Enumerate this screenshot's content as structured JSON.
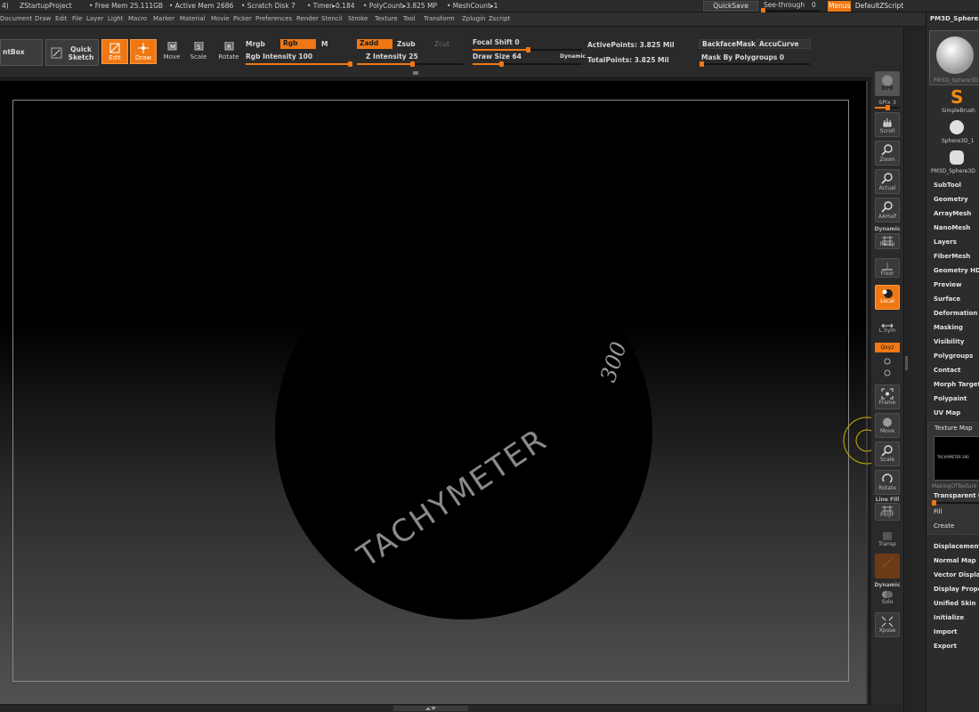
{
  "titlebar": {
    "fragments": [
      "4)",
      "ZStartupProject",
      "• Free Mem 25.111GB",
      "• Active Mem 2686",
      "• Scratch Disk 7",
      "• Timer▸0.184",
      "• PolyCount▸3.825 MP",
      "• MeshCount▸1"
    ],
    "quicksave": "QuickSave",
    "see_through": "See-through",
    "see_through_value": "0",
    "menus": "Menus",
    "default_zscript": "DefaultZScript"
  },
  "menubar": [
    "Document",
    "Draw",
    "Edit",
    "File",
    "Layer",
    "Light",
    "Macro",
    "Marker",
    "Material",
    "Movie",
    "Picker",
    "Preferences",
    "Render",
    "Stencil",
    "Stroke",
    "Texture",
    "Tool",
    "Transform",
    "Zplugin",
    "Zscript"
  ],
  "shelf": {
    "lightbox": "ntBox",
    "quick_sketch": "Quick Sketch",
    "edit": "Edit",
    "draw": "Draw",
    "move": "Move",
    "scale": "Scale",
    "rotate": "Rotate",
    "mrgb": "Mrgb",
    "rgb": "Rgb",
    "m": "M",
    "zadd": "Zadd",
    "zsub": "Zsub",
    "zcut": "Zcut",
    "rgb_intensity": "Rgb Intensity 100",
    "z_intensity": "Z Intensity 25",
    "focal_shift": "Focal Shift 0",
    "draw_size": "Draw Size 64",
    "dynamic": "Dynamic",
    "active_points": "ActivePoints: 3.825 Mil",
    "total_points": "TotalPoints: 3.825 Mil",
    "backface_mask": "BackfaceMask",
    "accu_curve": "AccuCurve",
    "mask_by_polygroups": "Mask By Polygroups 0"
  },
  "canvas": {
    "text_main": "TACHYMETER",
    "text_number": "300"
  },
  "rightcol": {
    "bpr": "BPR",
    "spix": "SPix 3",
    "scroll": "Scroll",
    "zoom": "Zoom",
    "actual": "Actual",
    "aahalf": "AAHalf",
    "dynamic": "Dynamic",
    "persp": "Persp",
    "floor": "Floor",
    "local": "Local",
    "lsym": "L.Sym",
    "xyz": "Qxyz",
    "frame": "Frame",
    "move": "Move",
    "scale": "Scale",
    "rotate": "Rotate",
    "line_fill": "Line Fill",
    "polyf": "PolyF",
    "transp": "Transp",
    "dynamic2": "Dynamic",
    "solo": "Solo",
    "xpose": "Xpose"
  },
  "palette": {
    "header": "PM3D_Sphere3",
    "thumb_main_caption": "PM3D_Sphere3D",
    "simple_brush": "SimpleBrush",
    "sphere3d": "Sphere3D_1",
    "pm3d_sphere": "PM3D_Sphere3D",
    "items_top": [
      "SubTool",
      "Geometry",
      "ArrayMesh",
      "NanoMesh",
      "Layers",
      "FiberMesh",
      "Geometry HD",
      "Preview",
      "Surface",
      "Deformation",
      "Masking",
      "Visibility",
      "Polygroups",
      "Contact",
      "Morph Target",
      "Polypaint",
      "UV Map"
    ],
    "texture_map": "Texture Map",
    "texture_caption": "MakingOfTexture",
    "texture_thumb_text": "TACHYMETER 300",
    "transparent": "Transparent 0",
    "fill": "Fill",
    "create": "Create",
    "items_bottom": [
      "Displacement",
      "Normal Map",
      "Vector Displa",
      "Display Prope",
      "Unified Skin",
      "Initialize",
      "Import",
      "Export"
    ]
  }
}
